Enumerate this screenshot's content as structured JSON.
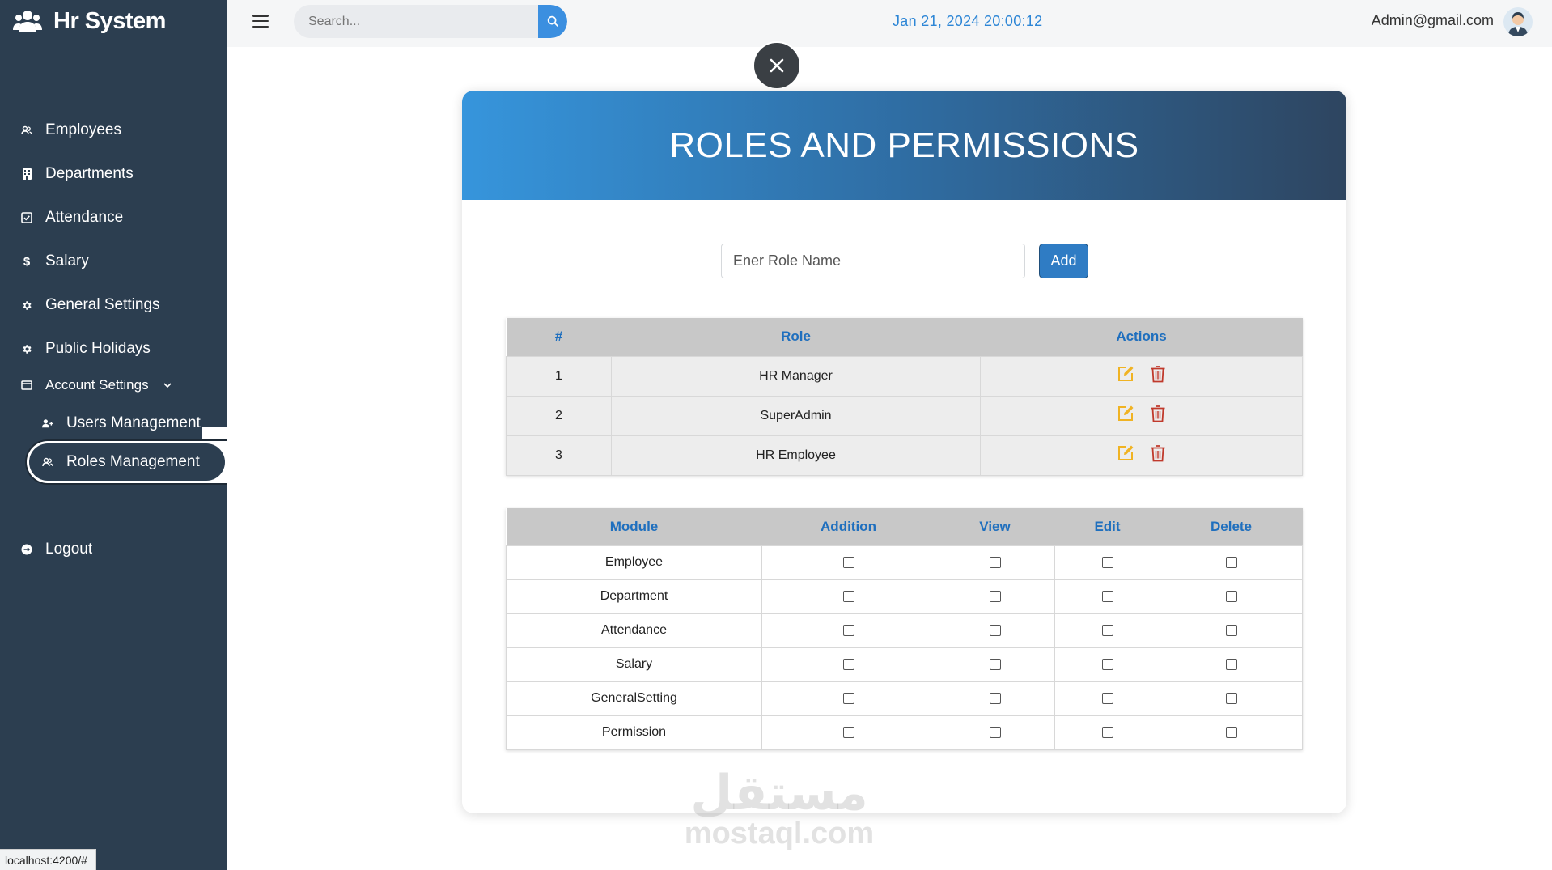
{
  "app": {
    "title": "Hr System"
  },
  "topbar": {
    "search_placeholder": "Search...",
    "datetime": "Jan 21, 2024 20:00:12",
    "user_email": "Admin@gmail.com"
  },
  "sidebar": {
    "items": [
      {
        "label": "Employees",
        "icon": "users-icon"
      },
      {
        "label": "Departments",
        "icon": "building-icon"
      },
      {
        "label": "Attendance",
        "icon": "calendar-check-icon"
      },
      {
        "label": "Salary",
        "icon": "dollar-icon"
      },
      {
        "label": "General Settings",
        "icon": "gear-icon"
      },
      {
        "label": "Public Holidays",
        "icon": "gear-icon"
      }
    ],
    "account_settings": {
      "label": "Account Settings",
      "icon": "window-icon"
    },
    "users_management": {
      "label": "Users Management",
      "icon": "user-plus-icon"
    },
    "roles_management": {
      "label": "Roles Management",
      "icon": "users-icon"
    },
    "logout": {
      "label": "Logout",
      "icon": "logout-icon"
    }
  },
  "card": {
    "title": "ROLES AND PERMISSIONS",
    "role_input_placeholder": "Ener Role Name",
    "add_label": "Add"
  },
  "roles_table": {
    "headers": [
      "#",
      "Role",
      "Actions"
    ],
    "rows": [
      {
        "num": "1",
        "role": "HR Manager"
      },
      {
        "num": "2",
        "role": "SuperAdmin"
      },
      {
        "num": "3",
        "role": "HR Employee"
      }
    ]
  },
  "permissions_table": {
    "headers": [
      "Module",
      "Addition",
      "View",
      "Edit",
      "Delete"
    ],
    "rows": [
      {
        "module": "Employee",
        "addition": false,
        "view": false,
        "edit": false,
        "delete": false
      },
      {
        "module": "Department",
        "addition": false,
        "view": false,
        "edit": false,
        "delete": false
      },
      {
        "module": "Attendance",
        "addition": false,
        "view": false,
        "edit": false,
        "delete": false
      },
      {
        "module": "Salary",
        "addition": false,
        "view": false,
        "edit": false,
        "delete": false
      },
      {
        "module": "GeneralSetting",
        "addition": false,
        "view": false,
        "edit": false,
        "delete": false
      },
      {
        "module": "Permission",
        "addition": false,
        "view": false,
        "edit": false,
        "delete": false
      }
    ]
  },
  "watermark": {
    "arabic": "مستقل",
    "latin": "mostaql.com"
  },
  "statusbar": {
    "url": "localhost:4200/#"
  },
  "colors": {
    "sidebar_bg": "#2c3e50",
    "accent_blue": "#2d86d6",
    "header_gradient_start": "#3695dc",
    "header_gradient_end": "#2e4560",
    "edit_icon": "#f0b323",
    "delete_icon": "#c0392b"
  }
}
